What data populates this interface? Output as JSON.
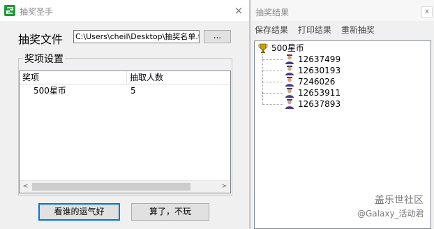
{
  "left_window": {
    "title": "抽奖圣手",
    "close_glyph": "×",
    "file_label": "抽奖文件",
    "file_path": "C:\\Users\\cheil\\Desktop\\抽奖名单.t",
    "browse_label": "...",
    "group_title": "奖项设置",
    "columns": [
      "奖项",
      "抽取人数"
    ],
    "rows": [
      {
        "prize": "500星币",
        "count": "5"
      }
    ],
    "scroll_left": "<",
    "scroll_right": ">",
    "draw_button": "看谁的运气好",
    "quit_button": "算了，不玩"
  },
  "right_window": {
    "title": "抽奖结果",
    "close_glyph": "x",
    "menu": [
      "保存结果",
      "打印结果",
      "重新抽奖"
    ],
    "tree_root": "500星币",
    "winners": [
      "12637499",
      "12630193",
      "7246026",
      "12653911",
      "12637893"
    ]
  },
  "watermark": {
    "line1": "盖乐世社区",
    "line2": "@Galaxy_活动君"
  },
  "colors": {
    "window_bg": "#f0f0f0",
    "default_button_border": "#0078d7",
    "app_icon": "#1e9a3a"
  },
  "icons": {
    "app": "app-logo-icon",
    "trophy": "trophy-icon",
    "person": "person-icon"
  }
}
